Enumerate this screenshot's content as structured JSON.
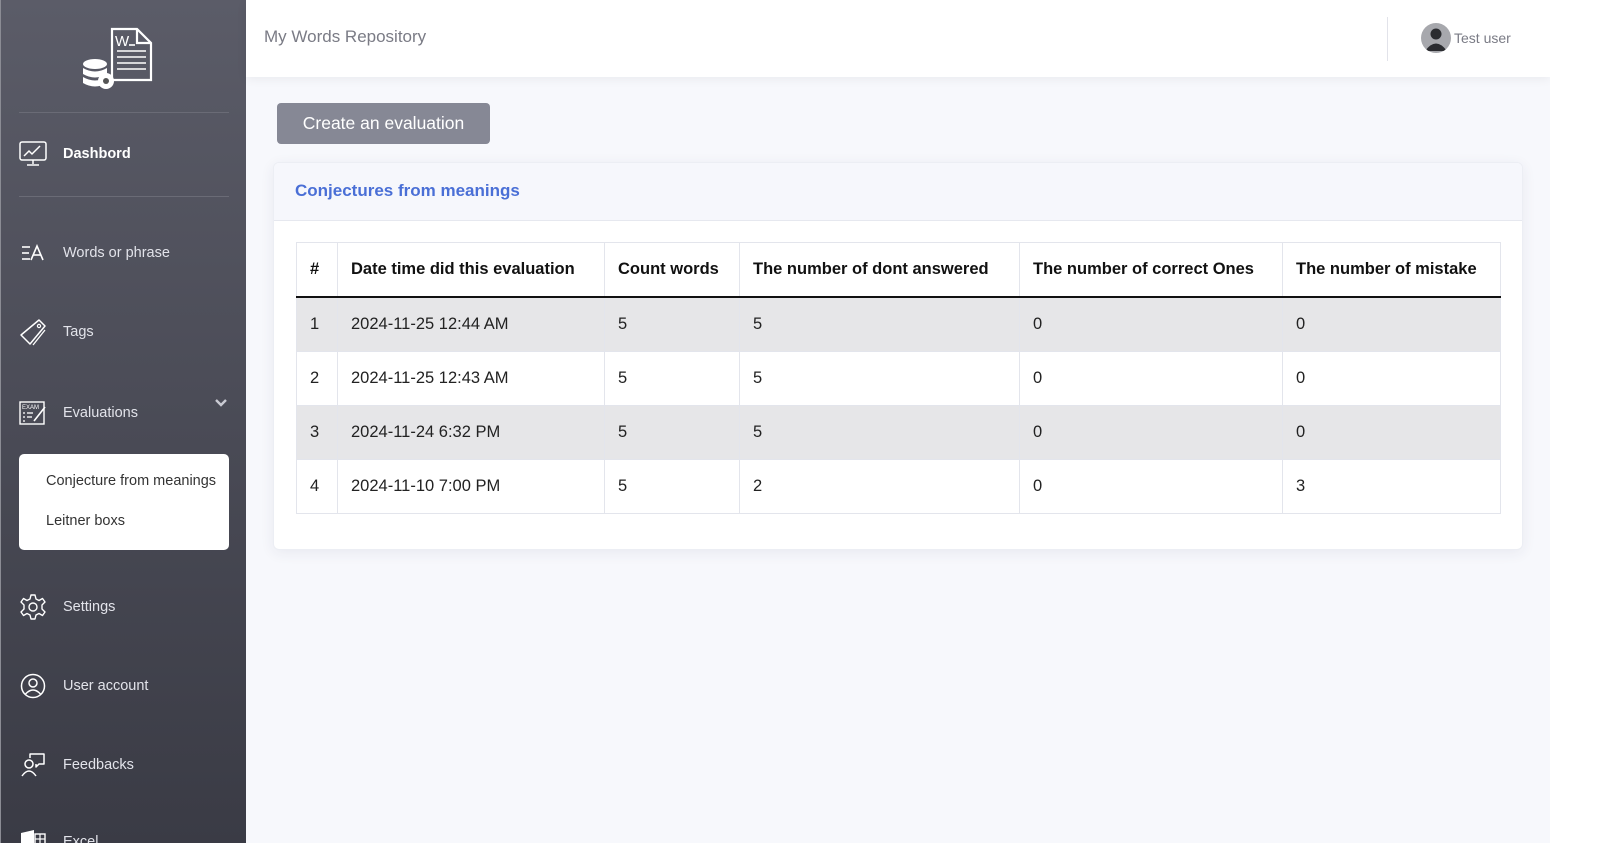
{
  "app": {
    "title": "My Words Repository"
  },
  "user": {
    "name": "Test user",
    "icon": "user-avatar-icon"
  },
  "sidebar": {
    "logo_icon": "words-repository-logo",
    "items": [
      {
        "label": "Dashbord",
        "icon": "monitor-chart-icon",
        "active": true
      },
      {
        "label": "Words or phrase",
        "icon": "text-translate-icon"
      },
      {
        "label": "Tags",
        "icon": "tags-icon"
      },
      {
        "label": "Evaluations",
        "icon": "exam-icon",
        "expanded": true
      },
      {
        "label": "Settings",
        "icon": "gear-icon"
      },
      {
        "label": "User account",
        "icon": "user-circle-icon"
      },
      {
        "label": "Feedbacks",
        "icon": "feedback-icon"
      },
      {
        "label": "Excel",
        "icon": "excel-icon"
      }
    ],
    "evaluations_submenu": [
      {
        "label": "Conjecture from meanings"
      },
      {
        "label": "Leitner boxs"
      }
    ]
  },
  "main": {
    "create_button": "Create an evaluation",
    "card": {
      "title": "Conjectures from meanings",
      "table": {
        "columns": [
          "#",
          "Date time did this evaluation",
          "Count words",
          "The number of dont answered",
          "The number of correct Ones",
          "The number of mistake"
        ],
        "rows": [
          [
            "1",
            "2024-11-25 12:44 AM",
            "5",
            "5",
            "0",
            "0"
          ],
          [
            "2",
            "2024-11-25 12:43 AM",
            "5",
            "5",
            "0",
            "0"
          ],
          [
            "3",
            "2024-11-24 6:32 PM",
            "5",
            "5",
            "0",
            "0"
          ],
          [
            "4",
            "2024-11-10 7:00 PM",
            "5",
            "2",
            "0",
            "3"
          ]
        ]
      }
    }
  },
  "colors": {
    "accent": "#4a6fd6",
    "button": "#868895",
    "sidebar_top": "#5b5c68",
    "sidebar_bottom": "#3a3b45"
  }
}
